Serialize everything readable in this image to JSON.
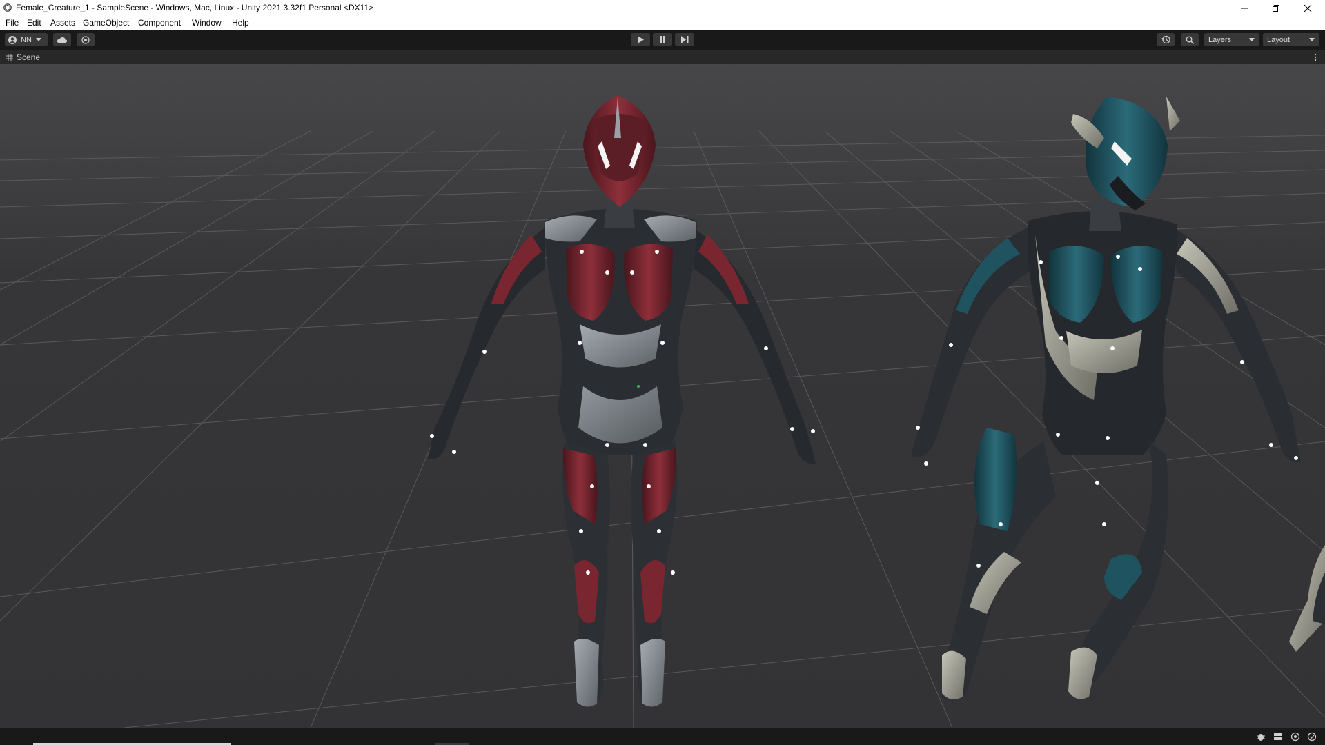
{
  "window": {
    "title": "Female_Creature_1 - SampleScene - Windows, Mac, Linux - Unity 2021.3.32f1 Personal <DX11>"
  },
  "menu": [
    "File",
    "Edit",
    "Assets",
    "GameObject",
    "Component",
    "Window",
    "Help"
  ],
  "toolbar": {
    "account_label": "NN",
    "layers_label": "Layers",
    "layout_label": "Layout"
  },
  "scene_tab": {
    "label": "Scene"
  },
  "characters": [
    {
      "name": "female-creature-crimson",
      "accent": "#7a2630",
      "armor": "#8d939a",
      "suit": "#1e2023"
    },
    {
      "name": "female-creature-teal",
      "accent": "#1f5360",
      "armor": "#a8a89c",
      "suit": "#1e2023"
    }
  ],
  "colors": {
    "toolbar_bg": "#191919",
    "viewport_bg": "#363638",
    "grid_line": "#6a6a6c"
  }
}
